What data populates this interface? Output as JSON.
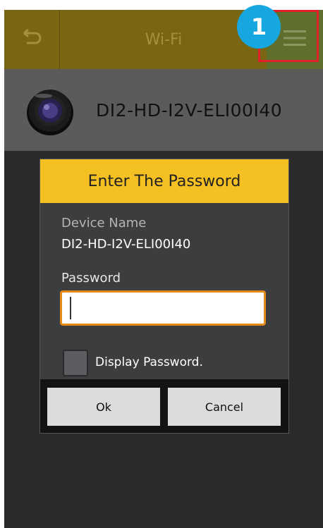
{
  "appbar": {
    "title": "Wi-Fi",
    "back_icon": "back-arrow-icon",
    "menu_icon": "hamburger-menu-icon",
    "step_badge": "1",
    "highlight_color": "#e0202b",
    "badge_color": "#17a7e0"
  },
  "device": {
    "icon": "camera-lens-icon",
    "name": "DI2-HD-I2V-ELI00I40"
  },
  "dialog": {
    "title": "Enter The Password",
    "device_name_label": "Device Name",
    "device_name_value": "DI2-HD-I2V-ELI00I40",
    "password_label": "Password",
    "password_value": "",
    "display_password_label": "Display Password.",
    "display_password_checked": false,
    "ok_label": "Ok",
    "cancel_label": "Cancel",
    "header_color": "#f5c122",
    "input_border_color": "#e58a18"
  }
}
